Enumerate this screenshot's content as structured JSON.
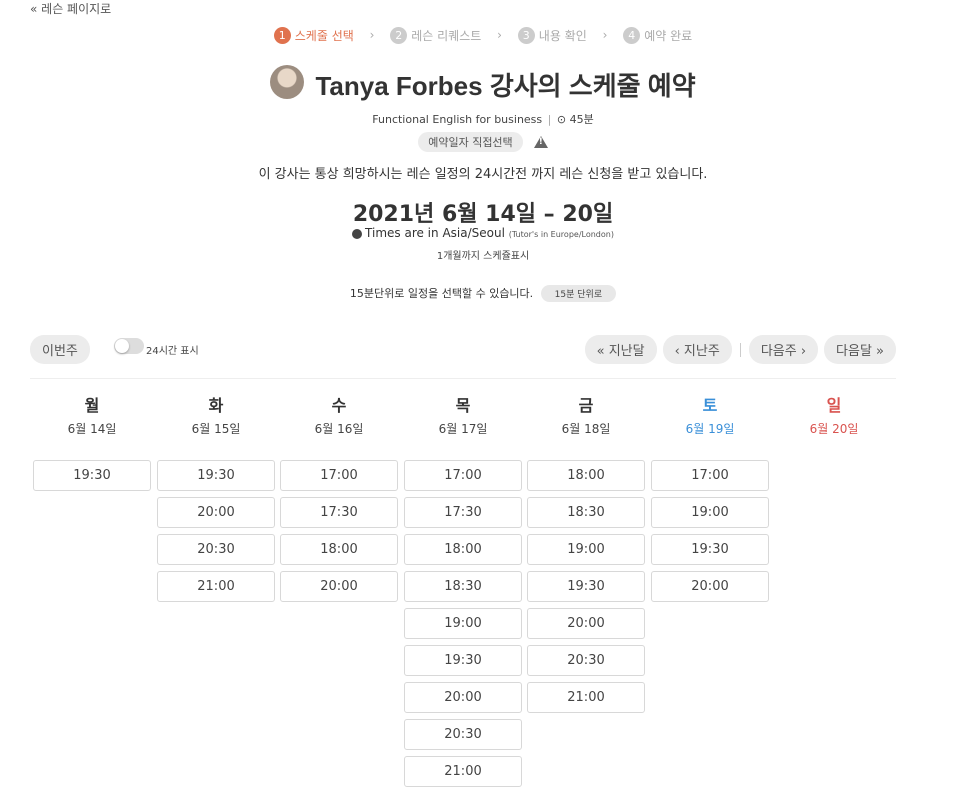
{
  "back_link": "« 레슨 페이지로",
  "steps": [
    {
      "num": "1",
      "label": "스케줄 선택",
      "active": true
    },
    {
      "num": "2",
      "label": "레슨 리퀘스트",
      "active": false
    },
    {
      "num": "3",
      "label": "내용 확인",
      "active": false
    },
    {
      "num": "4",
      "label": "예약 완료",
      "active": false
    }
  ],
  "step_sep": "›",
  "title": "Tanya Forbes 강사의 스케줄 예약",
  "course": "Functional English for business",
  "duration": "⊙ 45분",
  "booking_badge": "예약일자 직접선택",
  "notice": "이 강사는 통상 희망하시는 레슨 일정의 24시간전 까지 레슨 신청을 받고 있습니다.",
  "week_range": "2021년 6월 14일 – 20일",
  "timezone": "Times are in Asia/Seoul",
  "timezone_tutor": "(Tutor's in Europe/London)",
  "range_note": "1개월까지 스케쥴표시",
  "unit_note": "15분단위로 일정을 선택할 수 있습니다.",
  "unit_button": "15분 단위로",
  "toolbar": {
    "this_week": "이번주",
    "toggle_label": "24시간 표시",
    "prev_month": "« 지난달",
    "prev_week": "‹ 지난주",
    "next_week": "다음주 ›",
    "next_month": "다음달 »"
  },
  "days": [
    {
      "name": "월",
      "date": "6월 14일",
      "slots": [
        "19:30"
      ]
    },
    {
      "name": "화",
      "date": "6월 15일",
      "slots": [
        "19:30",
        "20:00",
        "20:30",
        "21:00"
      ]
    },
    {
      "name": "수",
      "date": "6월 16일",
      "slots": [
        "17:00",
        "17:30",
        "18:00",
        "20:00"
      ]
    },
    {
      "name": "목",
      "date": "6월 17일",
      "slots": [
        "17:00",
        "17:30",
        "18:00",
        "18:30",
        "19:00",
        "19:30",
        "20:00",
        "20:30",
        "21:00"
      ]
    },
    {
      "name": "금",
      "date": "6월 18일",
      "slots": [
        "18:00",
        "18:30",
        "19:00",
        "19:30",
        "20:00",
        "20:30",
        "21:00"
      ]
    },
    {
      "name": "토",
      "date": "6월 19일",
      "slots": [
        "17:00",
        "19:00",
        "19:30",
        "20:00"
      ]
    },
    {
      "name": "일",
      "date": "6월 20일",
      "slots": []
    }
  ],
  "colors": {
    "accent": "#e0724e",
    "saturday": "#3a8fd8",
    "sunday": "#d9534f"
  }
}
